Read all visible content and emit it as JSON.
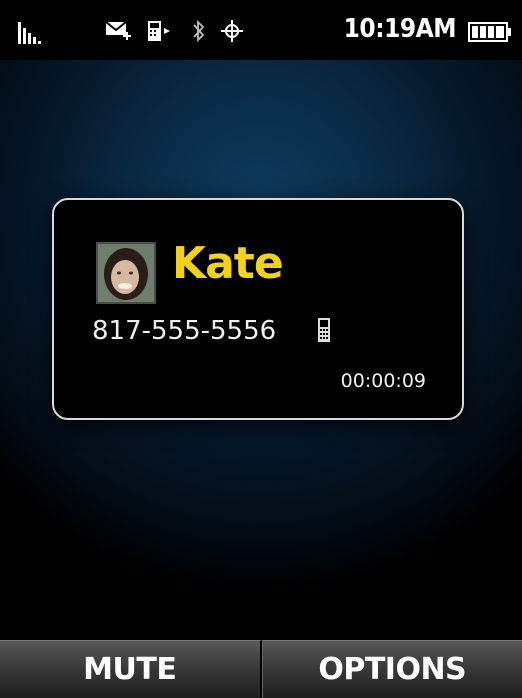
{
  "status_bar": {
    "time": "10:19AM",
    "icons": [
      "signal-icon",
      "new-message-icon",
      "phone-icon",
      "bluetooth-icon",
      "gps-icon",
      "battery-icon"
    ]
  },
  "call": {
    "contact_name": "Kate",
    "phone_number": "817-555-5556",
    "number_type_icon": "mobile-phone-icon",
    "duration": "00:00:09"
  },
  "softkeys": {
    "left_label": "MUTE",
    "right_label": "OPTIONS"
  },
  "colors": {
    "contact_name": "#f2d21d",
    "background_glow": "#0e3a5c"
  }
}
